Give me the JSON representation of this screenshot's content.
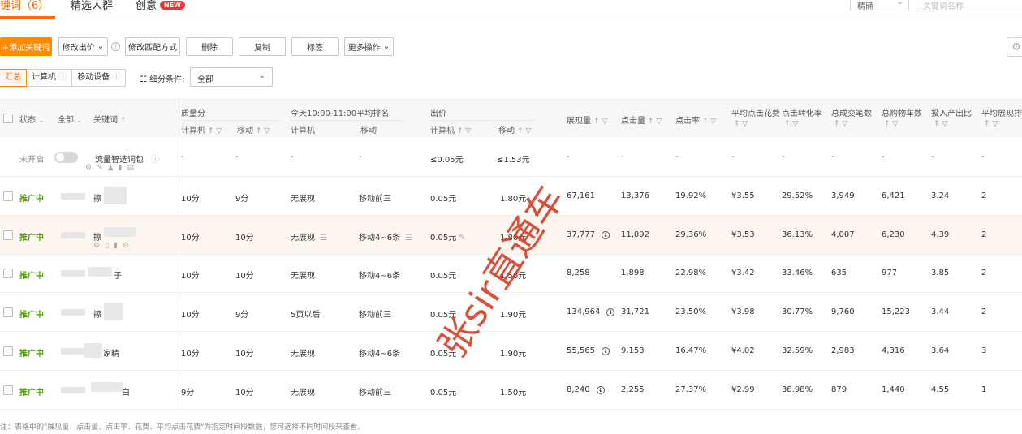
{
  "tabs": [
    {
      "label": "键词（6）",
      "active": true
    },
    {
      "label": "精选人群",
      "active": false
    },
    {
      "label": "创意",
      "active": false,
      "badge": "NEW"
    }
  ],
  "top_filter": {
    "select_value": "精确",
    "search_placeholder": "关键词名称"
  },
  "toolbar": {
    "add_keyword": "+添加关键词",
    "edit_bid": "修改出价",
    "edit_match": "修改匹配方式",
    "delete": "删除",
    "copy": "复制",
    "tags": "标签",
    "more_actions": "更多操作"
  },
  "segments": [
    "汇总",
    "计算机",
    "移动设备"
  ],
  "filter": {
    "label": "细分条件:",
    "value": "全部"
  },
  "table": {
    "headers": {
      "status": "状态",
      "all": "全部",
      "keyword": "关键词",
      "quality": "质量分",
      "quality_pc": "计算机",
      "quality_mobile": "移动",
      "rank_group": "今天10:00-11:00平均排名",
      "rank_pc": "计算机",
      "rank_mobile": "移动",
      "bid_group": "出价",
      "bid_pc": "计算机",
      "bid_mobile": "移动",
      "impressions": "展现量",
      "clicks": "点击量",
      "ctr": "点击率",
      "avg_cpc": "平均点击花费",
      "cvr": "点击转化率",
      "orders": "总成交笔数",
      "carts": "总购物车数",
      "roi": "投入产出比",
      "avg_rank": "平均展现排名"
    },
    "package_row": {
      "status": "未开启",
      "keyword": "流量智选词包",
      "quality_pc": "-",
      "quality_mobile": "-",
      "rank_pc": "-",
      "rank_mobile": "-",
      "bid_pc": "≤0.05元",
      "bid_mobile": "≤1.53元",
      "impressions": "-",
      "clicks": "-",
      "ctr": "-",
      "avg_cpc": "-",
      "cvr": "-",
      "orders": "-",
      "carts": "-",
      "roi": "-",
      "avg_rank": "-"
    },
    "rows": [
      {
        "status": "推广中",
        "keyword": "擦",
        "quality_pc": "10分",
        "quality_mobile": "9分",
        "rank_pc": "无展现",
        "rank_mobile": "移动前三",
        "bid_pc": "0.05元",
        "bid_mobile": "1.80元",
        "impressions": "67,161",
        "clicks": "13,376",
        "ctr": "19.92%",
        "avg_cpc": "¥3.55",
        "cvr": "29.52%",
        "orders": "3,949",
        "carts": "6,421",
        "roi": "3.24",
        "avg_rank": "2"
      },
      {
        "status": "推广中",
        "keyword": "擦",
        "quality_pc": "10分",
        "quality_mobile": "10分",
        "rank_pc": "无展现",
        "rank_mobile": "移动4~6条",
        "bid_pc": "0.05元",
        "bid_mobile": "1.80元",
        "impressions": "37,777",
        "clicks": "11,092",
        "ctr": "29.36%",
        "avg_cpc": "¥3.53",
        "cvr": "36.13%",
        "orders": "4,007",
        "carts": "6,230",
        "roi": "4.39",
        "avg_rank": "2"
      },
      {
        "status": "推广中",
        "keyword": "子",
        "quality_pc": "10分",
        "quality_mobile": "10分",
        "rank_pc": "无展现",
        "rank_mobile": "移动4~6条",
        "bid_pc": "0.05元",
        "bid_mobile": "1.50元",
        "impressions": "8,258",
        "clicks": "1,898",
        "ctr": "22.98%",
        "avg_cpc": "¥3.42",
        "cvr": "33.46%",
        "orders": "635",
        "carts": "977",
        "roi": "3.85",
        "avg_rank": "2"
      },
      {
        "status": "推广中",
        "keyword": "擦",
        "quality_pc": "10分",
        "quality_mobile": "9分",
        "rank_pc": "5页以后",
        "rank_mobile": "移动前三",
        "bid_pc": "0.05元",
        "bid_mobile": "1.90元",
        "impressions": "134,964",
        "clicks": "31,721",
        "ctr": "23.50%",
        "avg_cpc": "¥3.98",
        "cvr": "30.77%",
        "orders": "9,760",
        "carts": "15,223",
        "roi": "3.44",
        "avg_rank": "2"
      },
      {
        "status": "推广中",
        "keyword": "家精",
        "quality_pc": "10分",
        "quality_mobile": "10分",
        "rank_pc": "无展现",
        "rank_mobile": "移动4~6条",
        "bid_pc": "0.05元",
        "bid_mobile": "1.90元",
        "impressions": "55,565",
        "clicks": "9,153",
        "ctr": "16.47%",
        "avg_cpc": "¥4.02",
        "cvr": "32.59%",
        "orders": "2,983",
        "carts": "4,316",
        "roi": "3.64",
        "avg_rank": "3"
      },
      {
        "status": "推广中",
        "keyword": "白",
        "quality_pc": "9分",
        "quality_mobile": "10分",
        "rank_pc": "无展现",
        "rank_mobile": "移动前三",
        "bid_pc": "0.05元",
        "bid_mobile": "1.50元",
        "impressions": "8,240",
        "clicks": "2,255",
        "ctr": "27.37%",
        "avg_cpc": "¥2.99",
        "cvr": "38.98%",
        "orders": "879",
        "carts": "1,440",
        "roi": "4.55",
        "avg_rank": "1"
      }
    ]
  },
  "footnote": "注：表格中的\"展现量、点击量、点击率、花费、平均点击花费\"为指定时间段数据，您可选择不同时间段来查看。",
  "watermark": "张sir直通车",
  "colors": {
    "accent": "#ff6a00",
    "status_green": "#52a011",
    "watermark": "#d23a22"
  }
}
